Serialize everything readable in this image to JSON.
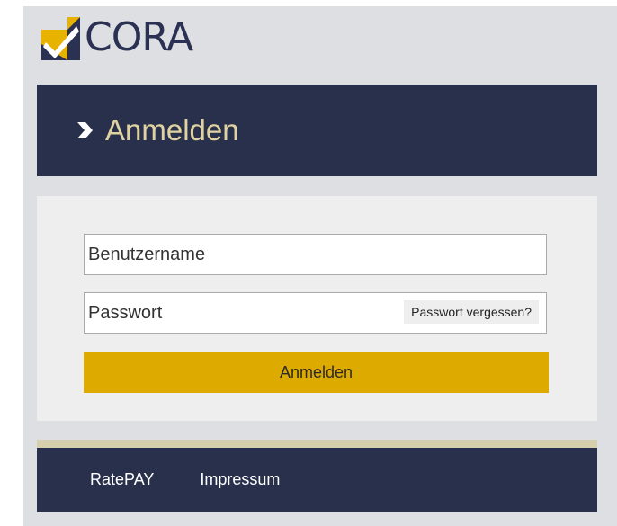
{
  "brand": {
    "logo_text": "CORA",
    "logo_icon": "cora-checkmark-logo"
  },
  "header": {
    "title": "Anmelden",
    "icon": "chevron-right-icon"
  },
  "login_form": {
    "username_placeholder": "Benutzername",
    "password_placeholder": "Passwort",
    "forgot_password_label": "Passwort vergessen?",
    "submit_label": "Anmelden"
  },
  "footer": {
    "links": [
      {
        "label": "RatePAY"
      },
      {
        "label": "Impressum"
      }
    ]
  },
  "colors": {
    "navy": "#29304c",
    "gold": "#ddaa00",
    "header_text": "#e0d3a1",
    "footer_accent": "#d6cfae",
    "background": "#dedfe3",
    "panel": "#eeeeee"
  }
}
